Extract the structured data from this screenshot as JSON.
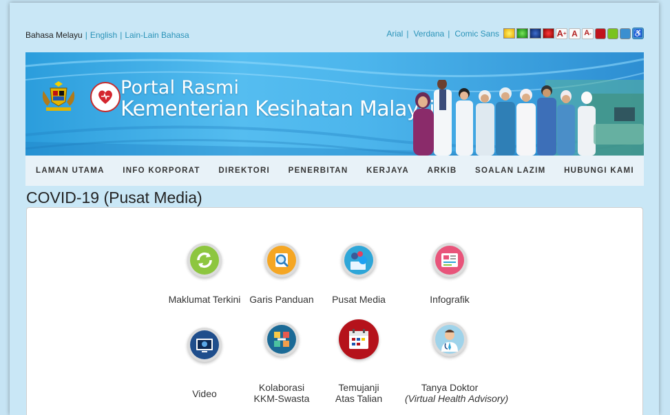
{
  "languages": {
    "current": "Bahasa Melayu",
    "english": "English",
    "others": "Lain-Lain Bahasa"
  },
  "fonts": {
    "arial": "Arial",
    "verdana": "Verdana",
    "comic": "Comic Sans"
  },
  "color_swatches": [
    "#f3c400",
    "#1fa21a",
    "#143a8a",
    "#c30000"
  ],
  "text_size_buttons": {
    "increase": "A",
    "increase_sup": "+",
    "normal": "A",
    "decrease": "A",
    "decrease_sup": "-"
  },
  "themes": [
    "#c0141c",
    "#7ac31e",
    "#3b8fd0"
  ],
  "banner": {
    "line1": "Portal Rasmi",
    "line2": "Kementerian Kesihatan Malaysia"
  },
  "nav": [
    "LAMAN UTAMA",
    "INFO KORPORAT",
    "DIREKTORI",
    "PENERBITAN",
    "KERJAYA",
    "ARKIB",
    "SOALAN LAZIM",
    "HUBUNGI KAMI"
  ],
  "page_title": "COVID-19 (Pusat Media)",
  "tiles": [
    {
      "label": "Maklumat Terkini",
      "icon": "refresh-icon",
      "color": "#8dc63f"
    },
    {
      "label": "Garis Panduan",
      "icon": "magnifier-document-icon",
      "color": "#f5a623"
    },
    {
      "label": "Pusat Media",
      "icon": "social-media-icon",
      "color": "#2ea6d8"
    },
    {
      "label": "Infografik",
      "icon": "infographic-icon",
      "color": "#e8547a"
    },
    {
      "label": "Video",
      "icon": "video-icon",
      "color": "#1f4e8c"
    },
    {
      "label_line1": "Kolaborasi",
      "label_line2": "KKM-Swasta",
      "icon": "handshake-collaboration-icon",
      "color": "#1b6a96"
    },
    {
      "label_line1": "Temujanji",
      "label_line2": "Atas Talian",
      "icon": "calendar-appointment-icon",
      "color": "#b5121b"
    },
    {
      "label_line1": "Tanya Doktor",
      "label_line2": "(Virtual Health Advisory)",
      "icon": "doctor-icon",
      "color": "#7cc3e0"
    }
  ]
}
